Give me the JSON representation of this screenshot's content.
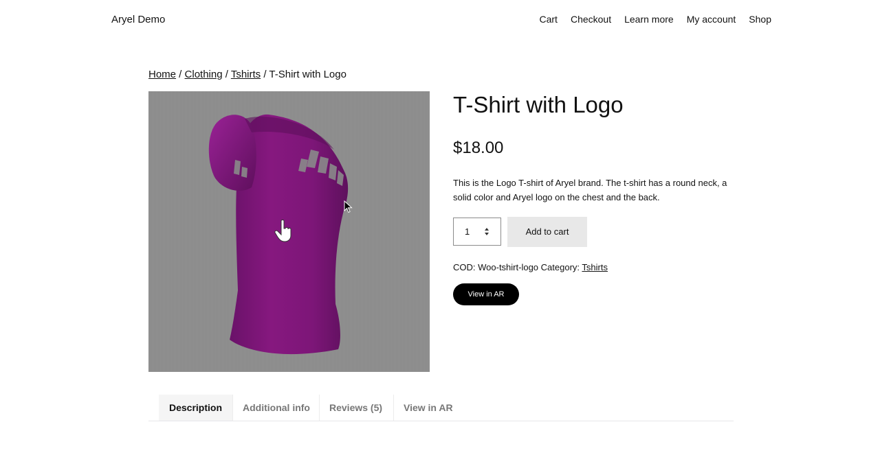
{
  "header": {
    "site_title": "Aryel Demo",
    "nav": [
      "Cart",
      "Checkout",
      "Learn more",
      "My account",
      "Shop"
    ]
  },
  "breadcrumb": {
    "items": [
      "Home",
      "Clothing",
      "Tshirts"
    ],
    "separator": " / ",
    "current": "T-Shirt with Logo"
  },
  "product": {
    "title": "T-Shirt with Logo",
    "price": "$18.00",
    "description": "This is the Logo T-shirt of Aryel brand. The t-shirt has a round neck, a solid color and Aryel logo on the chest and the back.",
    "quantity": "1",
    "add_to_cart_label": "Add to cart",
    "meta_cod_label": "COD:",
    "meta_cod_value": "Woo-tshirt-logo",
    "meta_category_label": "Category:",
    "meta_category_value": "Tshirts",
    "ar_button_label": "View in AR",
    "shirt_color": "#80157f",
    "viewer_bg": "#8e8e8e",
    "shirt_print": "Aryel"
  },
  "tabs": [
    {
      "label": "Description",
      "active": true
    },
    {
      "label": "Additional info",
      "active": false
    },
    {
      "label": "Reviews (5)",
      "active": false
    },
    {
      "label": "View in AR",
      "active": false
    }
  ]
}
